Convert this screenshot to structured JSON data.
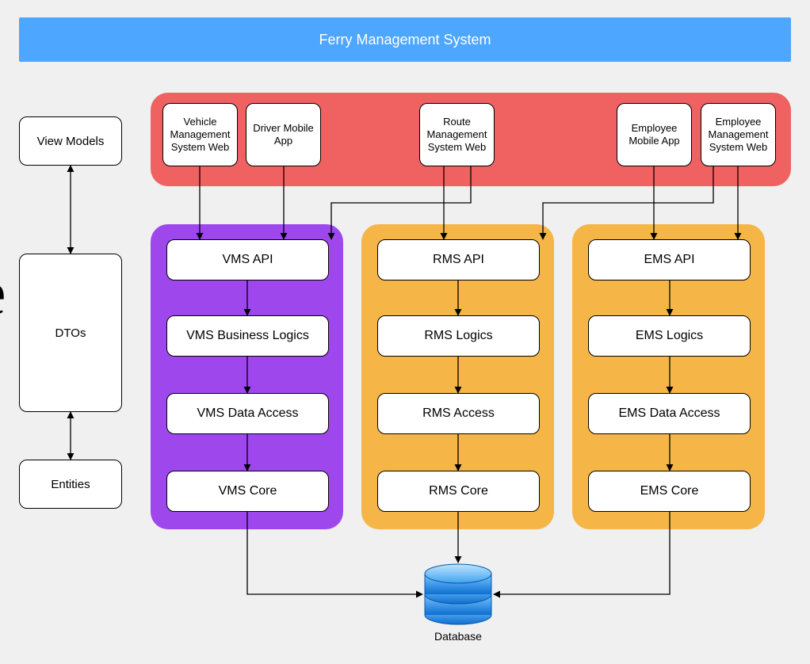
{
  "title": "Ferry Management System",
  "left_column": {
    "view_models": "View Models",
    "dtos": "DTOs",
    "entities": "Entities"
  },
  "partial_letter": "e",
  "front_row": {
    "vehicle_web": "Vehicle Management System Web",
    "driver_app": "Driver Mobile App",
    "route_web": "Route Management System Web",
    "employee_app": "Employee Mobile App",
    "employee_web": "Employee Management System Web"
  },
  "vms": {
    "api": "VMS API",
    "logic": "VMS Business Logics",
    "data": "VMS Data Access",
    "core": "VMS Core"
  },
  "rms": {
    "api": "RMS API",
    "logic": "RMS Logics",
    "data": "RMS Access",
    "core": "RMS Core"
  },
  "ems": {
    "api": "EMS API",
    "logic": "EMS Logics",
    "data": "EMS Data Access",
    "core": "EMS Core"
  },
  "database": "Database"
}
